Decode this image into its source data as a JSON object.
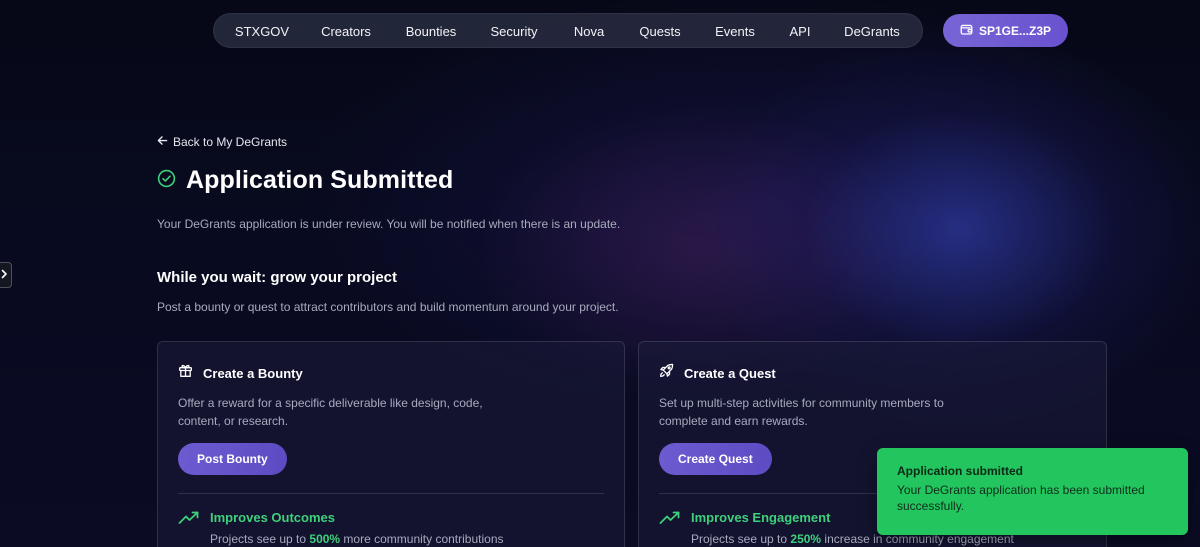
{
  "nav": {
    "items": [
      "STXGOV",
      "Creators",
      "Bounties",
      "Security",
      "Nova",
      "Quests",
      "Events",
      "API",
      "DeGrants"
    ],
    "wallet_label": "SP1GE...Z3P"
  },
  "back_link": "Back to My DeGrants",
  "page_title": "Application Submitted",
  "subtitle": "Your DeGrants application is under review. You will be notified when there is an update.",
  "section": {
    "title": "While you wait: grow your project",
    "description": "Post a bounty or quest to attract contributors and build momentum around your project."
  },
  "cards": [
    {
      "icon": "gift-icon",
      "title": "Create a Bounty",
      "description": "Offer a reward for a specific deliverable like design, code, content, or research.",
      "button": "Post Bounty",
      "benefit_title": "Improves Outcomes",
      "benefit_prefix": "Projects see up to ",
      "benefit_highlight": "500%",
      "benefit_suffix": " more community contributions"
    },
    {
      "icon": "rocket-icon",
      "title": "Create a Quest",
      "description": "Set up multi-step activities for community members to complete and earn rewards.",
      "button": "Create Quest",
      "benefit_title": "Improves Engagement",
      "benefit_prefix": "Projects see up to ",
      "benefit_highlight": "250%",
      "benefit_suffix": " increase in community engagement"
    }
  ],
  "toast": {
    "title": "Application submitted",
    "message": "Your DeGrants application has been submitted successfully."
  },
  "colors": {
    "accent_purple": "#6a52cf",
    "success_green": "#22c55e",
    "highlight_green": "#3ed07a",
    "background": "#080a1f"
  }
}
